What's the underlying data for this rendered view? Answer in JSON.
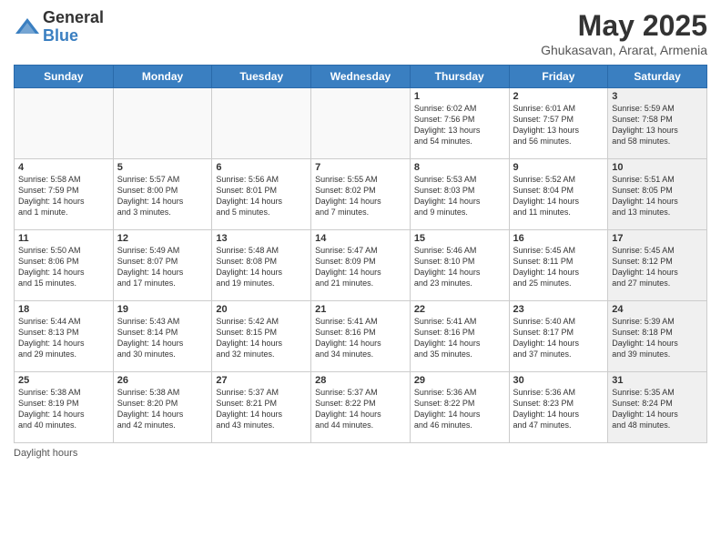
{
  "logo": {
    "general": "General",
    "blue": "Blue"
  },
  "title": "May 2025",
  "subtitle": "Ghukasavan, Ararat, Armenia",
  "days_of_week": [
    "Sunday",
    "Monday",
    "Tuesday",
    "Wednesday",
    "Thursday",
    "Friday",
    "Saturday"
  ],
  "footer": "Daylight hours",
  "weeks": [
    [
      {
        "day": "",
        "info": "",
        "empty": true
      },
      {
        "day": "",
        "info": "",
        "empty": true
      },
      {
        "day": "",
        "info": "",
        "empty": true
      },
      {
        "day": "",
        "info": "",
        "empty": true
      },
      {
        "day": "1",
        "info": "Sunrise: 6:02 AM\nSunset: 7:56 PM\nDaylight: 13 hours\nand 54 minutes."
      },
      {
        "day": "2",
        "info": "Sunrise: 6:01 AM\nSunset: 7:57 PM\nDaylight: 13 hours\nand 56 minutes."
      },
      {
        "day": "3",
        "info": "Sunrise: 5:59 AM\nSunset: 7:58 PM\nDaylight: 13 hours\nand 58 minutes.",
        "shaded": true
      }
    ],
    [
      {
        "day": "4",
        "info": "Sunrise: 5:58 AM\nSunset: 7:59 PM\nDaylight: 14 hours\nand 1 minute."
      },
      {
        "day": "5",
        "info": "Sunrise: 5:57 AM\nSunset: 8:00 PM\nDaylight: 14 hours\nand 3 minutes."
      },
      {
        "day": "6",
        "info": "Sunrise: 5:56 AM\nSunset: 8:01 PM\nDaylight: 14 hours\nand 5 minutes."
      },
      {
        "day": "7",
        "info": "Sunrise: 5:55 AM\nSunset: 8:02 PM\nDaylight: 14 hours\nand 7 minutes."
      },
      {
        "day": "8",
        "info": "Sunrise: 5:53 AM\nSunset: 8:03 PM\nDaylight: 14 hours\nand 9 minutes."
      },
      {
        "day": "9",
        "info": "Sunrise: 5:52 AM\nSunset: 8:04 PM\nDaylight: 14 hours\nand 11 minutes."
      },
      {
        "day": "10",
        "info": "Sunrise: 5:51 AM\nSunset: 8:05 PM\nDaylight: 14 hours\nand 13 minutes.",
        "shaded": true
      }
    ],
    [
      {
        "day": "11",
        "info": "Sunrise: 5:50 AM\nSunset: 8:06 PM\nDaylight: 14 hours\nand 15 minutes."
      },
      {
        "day": "12",
        "info": "Sunrise: 5:49 AM\nSunset: 8:07 PM\nDaylight: 14 hours\nand 17 minutes."
      },
      {
        "day": "13",
        "info": "Sunrise: 5:48 AM\nSunset: 8:08 PM\nDaylight: 14 hours\nand 19 minutes."
      },
      {
        "day": "14",
        "info": "Sunrise: 5:47 AM\nSunset: 8:09 PM\nDaylight: 14 hours\nand 21 minutes."
      },
      {
        "day": "15",
        "info": "Sunrise: 5:46 AM\nSunset: 8:10 PM\nDaylight: 14 hours\nand 23 minutes."
      },
      {
        "day": "16",
        "info": "Sunrise: 5:45 AM\nSunset: 8:11 PM\nDaylight: 14 hours\nand 25 minutes."
      },
      {
        "day": "17",
        "info": "Sunrise: 5:45 AM\nSunset: 8:12 PM\nDaylight: 14 hours\nand 27 minutes.",
        "shaded": true
      }
    ],
    [
      {
        "day": "18",
        "info": "Sunrise: 5:44 AM\nSunset: 8:13 PM\nDaylight: 14 hours\nand 29 minutes."
      },
      {
        "day": "19",
        "info": "Sunrise: 5:43 AM\nSunset: 8:14 PM\nDaylight: 14 hours\nand 30 minutes."
      },
      {
        "day": "20",
        "info": "Sunrise: 5:42 AM\nSunset: 8:15 PM\nDaylight: 14 hours\nand 32 minutes."
      },
      {
        "day": "21",
        "info": "Sunrise: 5:41 AM\nSunset: 8:16 PM\nDaylight: 14 hours\nand 34 minutes."
      },
      {
        "day": "22",
        "info": "Sunrise: 5:41 AM\nSunset: 8:16 PM\nDaylight: 14 hours\nand 35 minutes."
      },
      {
        "day": "23",
        "info": "Sunrise: 5:40 AM\nSunset: 8:17 PM\nDaylight: 14 hours\nand 37 minutes."
      },
      {
        "day": "24",
        "info": "Sunrise: 5:39 AM\nSunset: 8:18 PM\nDaylight: 14 hours\nand 39 minutes.",
        "shaded": true
      }
    ],
    [
      {
        "day": "25",
        "info": "Sunrise: 5:38 AM\nSunset: 8:19 PM\nDaylight: 14 hours\nand 40 minutes."
      },
      {
        "day": "26",
        "info": "Sunrise: 5:38 AM\nSunset: 8:20 PM\nDaylight: 14 hours\nand 42 minutes."
      },
      {
        "day": "27",
        "info": "Sunrise: 5:37 AM\nSunset: 8:21 PM\nDaylight: 14 hours\nand 43 minutes."
      },
      {
        "day": "28",
        "info": "Sunrise: 5:37 AM\nSunset: 8:22 PM\nDaylight: 14 hours\nand 44 minutes."
      },
      {
        "day": "29",
        "info": "Sunrise: 5:36 AM\nSunset: 8:22 PM\nDaylight: 14 hours\nand 46 minutes."
      },
      {
        "day": "30",
        "info": "Sunrise: 5:36 AM\nSunset: 8:23 PM\nDaylight: 14 hours\nand 47 minutes."
      },
      {
        "day": "31",
        "info": "Sunrise: 5:35 AM\nSunset: 8:24 PM\nDaylight: 14 hours\nand 48 minutes.",
        "shaded": true
      }
    ]
  ]
}
